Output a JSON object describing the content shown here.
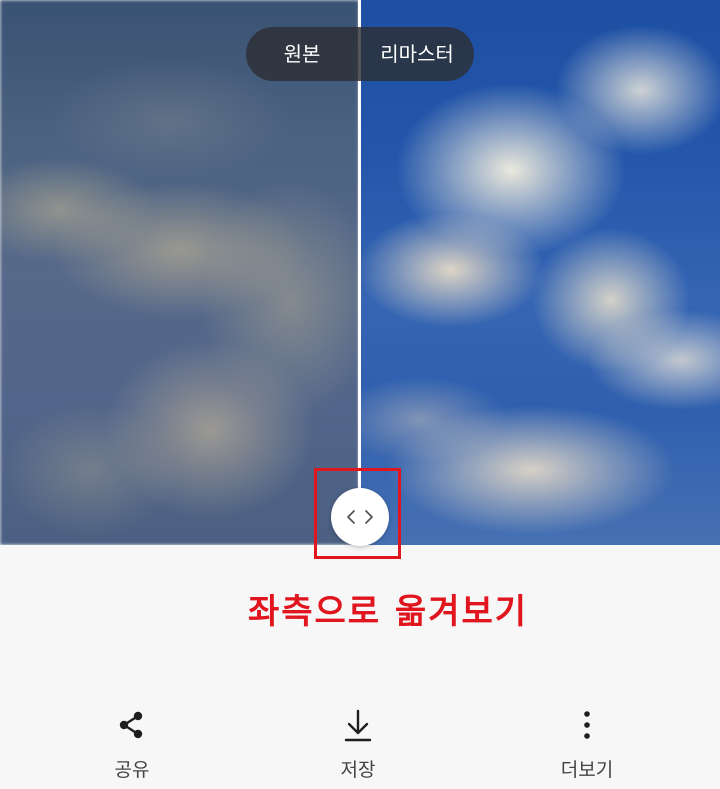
{
  "compare": {
    "original_label": "원본",
    "remaster_label": "리마스터"
  },
  "annotation": {
    "text": "좌측으로 옮겨보기",
    "color": "#e0151d"
  },
  "toolbar": {
    "share_label": "공유",
    "save_label": "저장",
    "more_label": "더보기"
  },
  "icons": {
    "share": "share-icon",
    "save": "download-icon",
    "more": "more-vertical-icon",
    "handle": "chevron-left-right-icon"
  }
}
